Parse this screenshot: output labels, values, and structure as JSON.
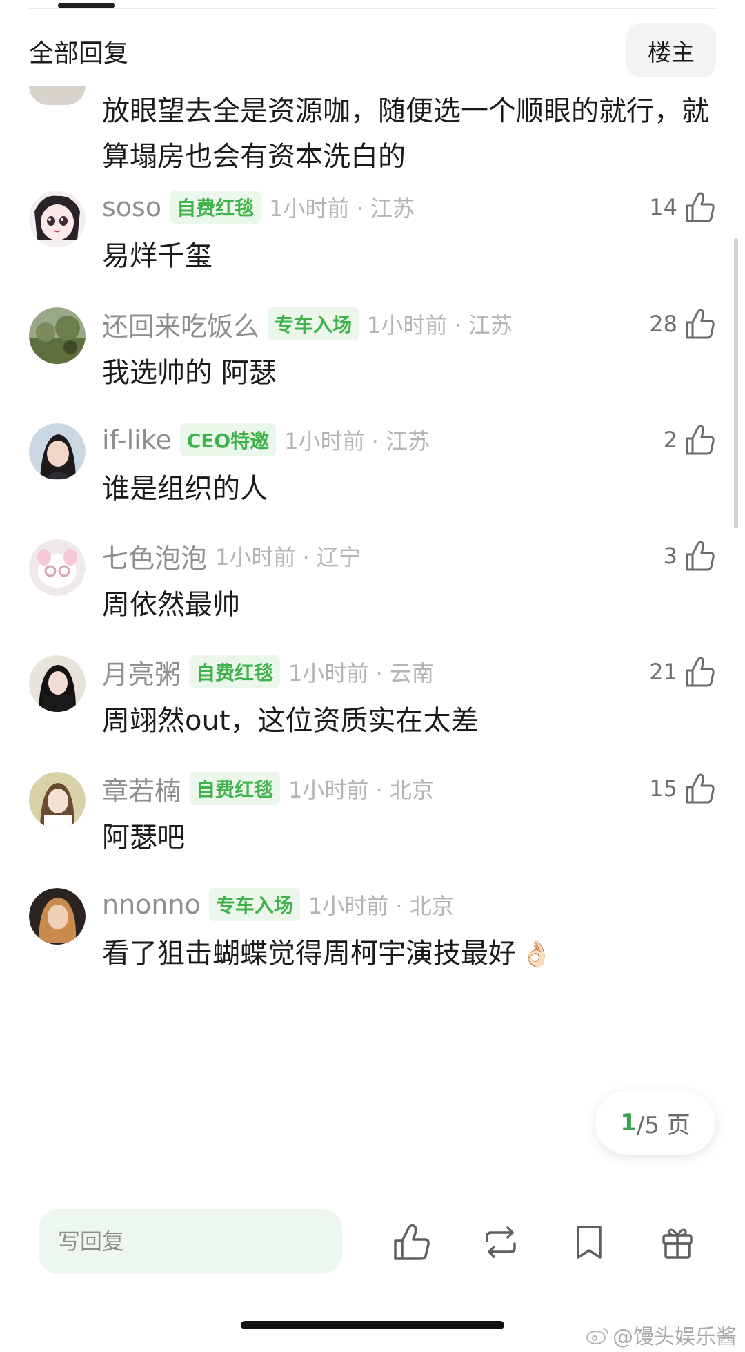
{
  "header": {
    "title": "全部回复",
    "filter_label": "楼主"
  },
  "top_comment": {
    "text": "放眼望去全是资源咖，随便选一个顺眼的就行，就算塌房也会有资本洗白的"
  },
  "comments": [
    {
      "name": "soso",
      "badge": "自费红毯",
      "time": "1小时前 · 江苏",
      "likes": "14",
      "text": "易烊千玺"
    },
    {
      "name": "还回来吃饭么",
      "badge": "专车入场",
      "time": "1小时前 · 江苏",
      "likes": "28",
      "text": "我选帅的 阿瑟"
    },
    {
      "name": "if-like",
      "badge": "CEO特邀",
      "time": "1小时前 · 江苏",
      "likes": "2",
      "text": "谁是组织的人"
    },
    {
      "name": "七色泡泡",
      "badge": "",
      "time": "1小时前 · 辽宁",
      "likes": "3",
      "text": "周依然最帅"
    },
    {
      "name": "月亮粥",
      "badge": "自费红毯",
      "time": "1小时前 · 云南",
      "likes": "21",
      "text": "周翊然out，这位资质实在太差"
    },
    {
      "name": "章若楠",
      "badge": "自费红毯",
      "time": "1小时前 · 北京",
      "likes": "15",
      "text": "阿瑟吧"
    },
    {
      "name": "nnonno",
      "badge": "专车入场",
      "time": "1小时前 · 北京",
      "likes": "",
      "text": "看了狙击蝴蝶觉得周柯宇演技最好"
    }
  ],
  "pager": {
    "current": "1",
    "total": "/5 页"
  },
  "bottom_bar": {
    "reply_placeholder": "写回复",
    "icons": [
      "like-icon",
      "repost-icon",
      "bookmark-icon",
      "gift-icon"
    ]
  },
  "watermark": "@馒头娱乐酱",
  "colors": {
    "badge_green": "#3fb24b",
    "badge_bg": "#eaf7ea",
    "pager_green": "#3fa14d",
    "input_bg": "#eef7ef"
  }
}
